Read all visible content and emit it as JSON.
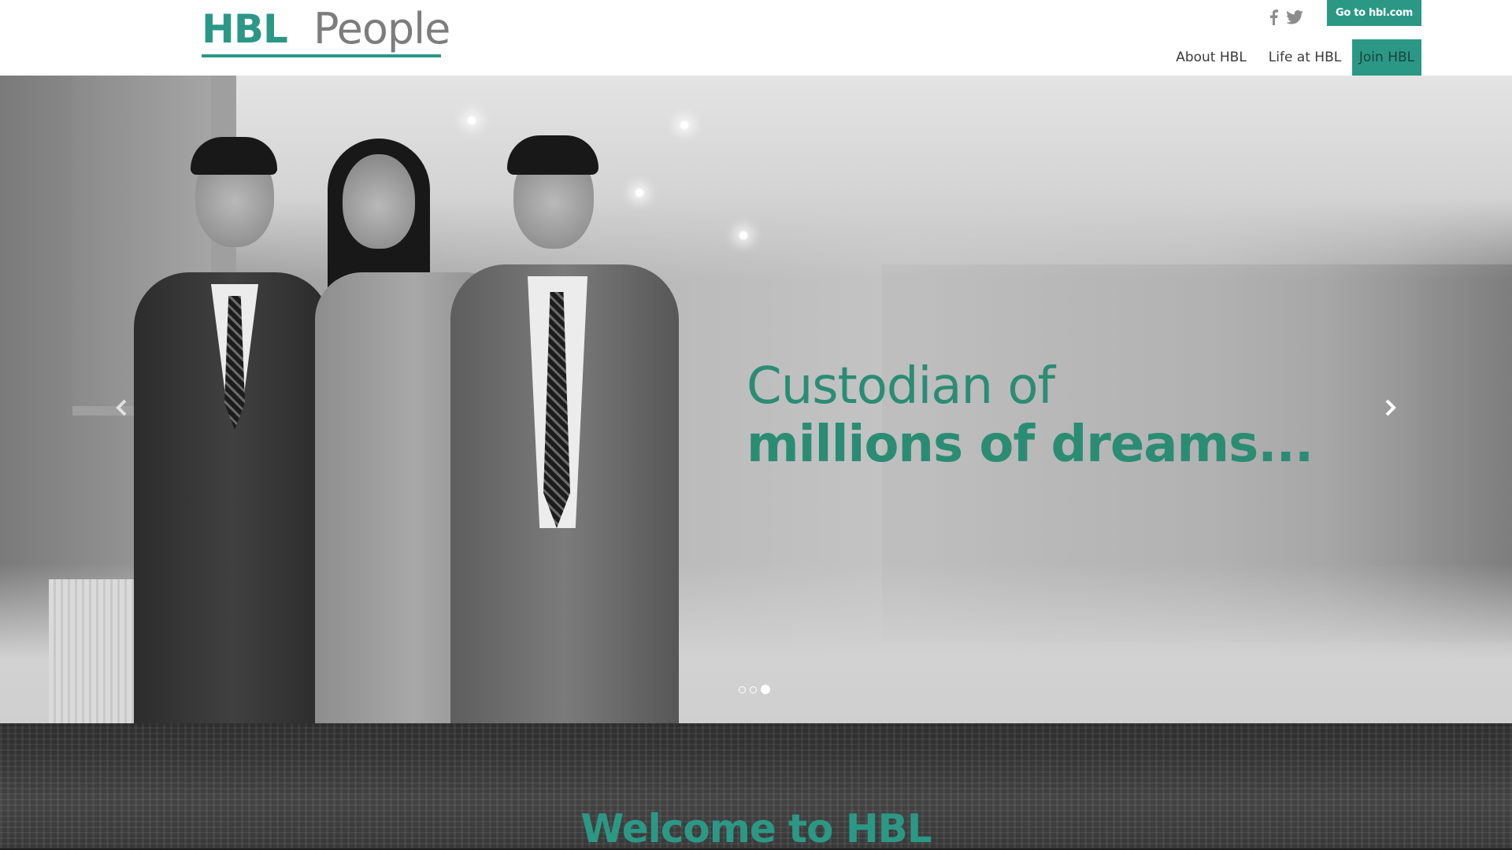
{
  "header": {
    "logo": {
      "brand": "HBL",
      "suffix": "People"
    },
    "social": [
      {
        "name": "facebook",
        "icon": "facebook-icon"
      },
      {
        "name": "twitter",
        "icon": "twitter-icon"
      }
    ],
    "goto_button": "Go to hbl.com",
    "nav": [
      {
        "label": "About HBL",
        "active": false
      },
      {
        "label": "Life at HBL",
        "active": false
      },
      {
        "label": "Join HBL",
        "active": true
      }
    ]
  },
  "hero": {
    "headline_line1": "Custodian of",
    "headline_line2": "millions of dreams...",
    "prev_icon": "chevron-left-icon",
    "next_icon": "chevron-right-icon",
    "slides_total": 3,
    "active_slide": 3
  },
  "welcome": {
    "title": "Welcome to HBL"
  },
  "colors": {
    "brand_green": "#2b9886",
    "headline_green": "#2b8c74",
    "logo_gray": "#7d7d7d",
    "nav_text": "#3a3a3a"
  }
}
